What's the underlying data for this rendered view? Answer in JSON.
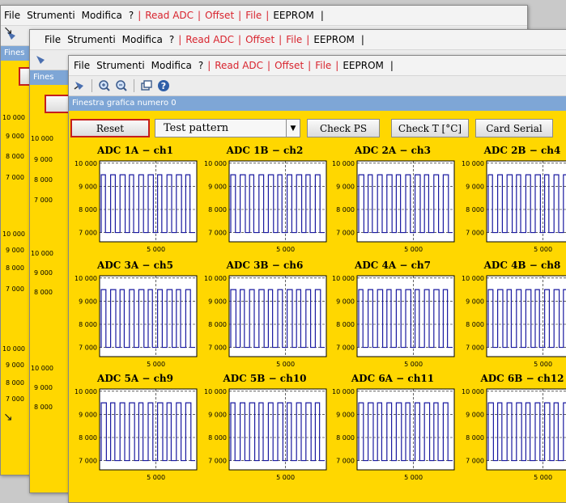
{
  "menu": {
    "file": "File",
    "tools": "Strumenti",
    "edit": "Modifica",
    "help": "?",
    "read_adc": "Read ADC",
    "offset": "Offset",
    "file2": "File",
    "eeprom": "EEPROM",
    "sep": "|"
  },
  "status_text": "Finestra grafica numero 0",
  "status_short": "Fines",
  "controls": {
    "reset": "Reset",
    "pattern_selected": "Test pattern",
    "check_ps": "Check PS",
    "check_t": "Check T [°C]",
    "card_serial": "Card Serial"
  },
  "y_ticks": [
    "10 000",
    "9 000",
    "8 000",
    "7 000"
  ],
  "x_tick": "5 000",
  "panels": [
    {
      "title": "ADC 1A  −  ch1"
    },
    {
      "title": "ADC 1B  −  ch2"
    },
    {
      "title": "ADC 2A  −  ch3"
    },
    {
      "title": "ADC 2B  −  ch4"
    },
    {
      "title": "ADC 3A  −  ch5"
    },
    {
      "title": "ADC 3B  −  ch6"
    },
    {
      "title": "ADC 4A  −  ch7"
    },
    {
      "title": "ADC 4B  −  ch8"
    },
    {
      "title": "ADC 5A  −  ch9"
    },
    {
      "title": "ADC 5B  −  ch10"
    },
    {
      "title": "ADC 6A  −  ch11"
    },
    {
      "title": "ADC 6B  −  ch12"
    }
  ],
  "chart_data": {
    "type": "line",
    "x_tick_labels": [
      "5 000"
    ],
    "y_tick_labels": [
      "10 000",
      "9 000",
      "8 000",
      "7 000"
    ],
    "ylim": [
      6600,
      10100
    ],
    "signal": "square wave test pattern, low ≈ 7000, high ≈ 9500",
    "colors": {
      "trace": "#1a1aa0",
      "background": "#ffd700"
    }
  }
}
